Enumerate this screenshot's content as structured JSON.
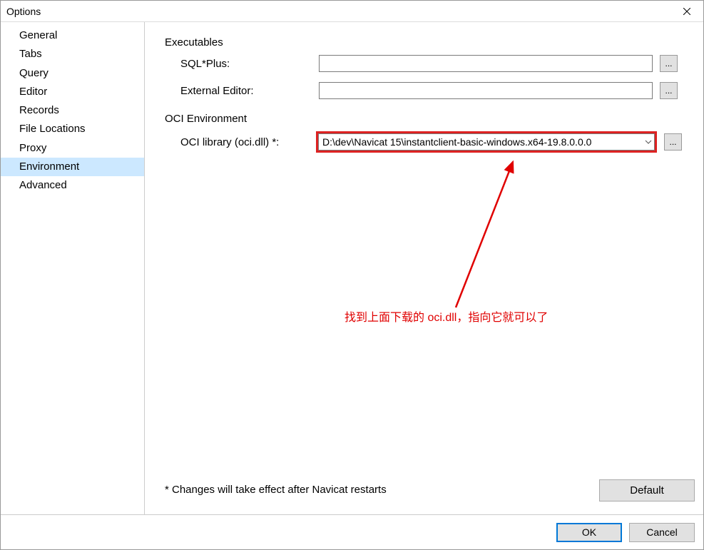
{
  "window": {
    "title": "Options"
  },
  "sidebar": {
    "items": [
      {
        "label": "General",
        "selected": false
      },
      {
        "label": "Tabs",
        "selected": false
      },
      {
        "label": "Query",
        "selected": false
      },
      {
        "label": "Editor",
        "selected": false
      },
      {
        "label": "Records",
        "selected": false
      },
      {
        "label": "File Locations",
        "selected": false
      },
      {
        "label": "Proxy",
        "selected": false
      },
      {
        "label": "Environment",
        "selected": true
      },
      {
        "label": "Advanced",
        "selected": false
      }
    ]
  },
  "content": {
    "executables_heading": "Executables",
    "sqlplus_label": "SQL*Plus:",
    "sqlplus_value": "",
    "external_editor_label": "External Editor:",
    "external_editor_value": "",
    "oci_heading": "OCI Environment",
    "oci_library_label": "OCI library (oci.dll) *:",
    "oci_library_value": "D:\\dev\\Navicat 15\\instantclient-basic-windows.x64-19.8.0.0.0",
    "browse_label": "...",
    "footer_note": "* Changes will take effect after Navicat restarts",
    "default_button": "Default"
  },
  "annotation": {
    "text": "找到上面下载的 oci.dll，指向它就可以了"
  },
  "buttons": {
    "ok": "OK",
    "cancel": "Cancel"
  }
}
